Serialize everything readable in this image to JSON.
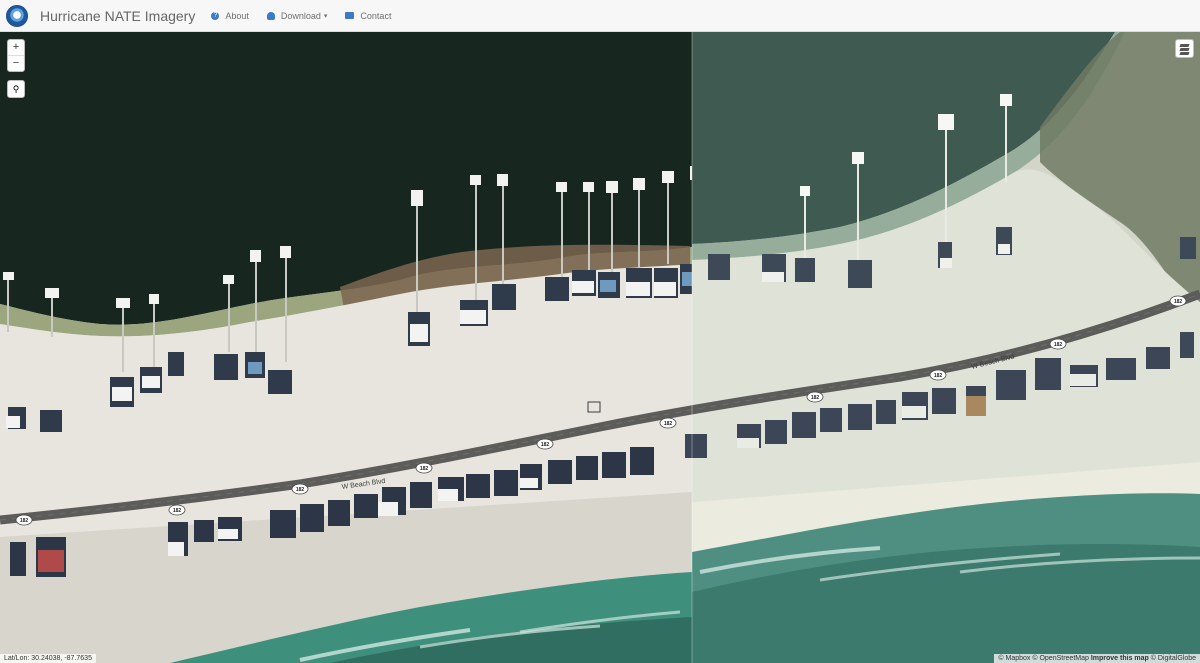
{
  "navbar": {
    "title": "Hurricane NATE Imagery",
    "about_label": "About",
    "download_label": "Download",
    "contact_label": "Contact"
  },
  "map": {
    "zoom_in": "+",
    "zoom_out": "−",
    "road_name": "W Beach Blvd",
    "route_number": "182",
    "latlon": "Lat/Lon: 30.24038, -87.7635",
    "attribution": {
      "mapbox": "© Mapbox",
      "osm": "© OpenStreetMap",
      "improve": "Improve this map",
      "digitalglobe": "© DigitalGlobe"
    }
  },
  "colors": {
    "nav_bg": "#f7f7f7",
    "accent": "#3b79c9",
    "water_dark": "#17261f",
    "water_right": "#3e5850",
    "sand": "#e9e7df",
    "road": "#5c5c5a",
    "gulf": "#3f8a7b"
  },
  "icons": {
    "logo": "noaa-logo",
    "about": "question-circle-icon",
    "download": "cloud-download-icon",
    "contact": "envelope-icon",
    "search": "search-icon",
    "layers": "layers-icon"
  }
}
